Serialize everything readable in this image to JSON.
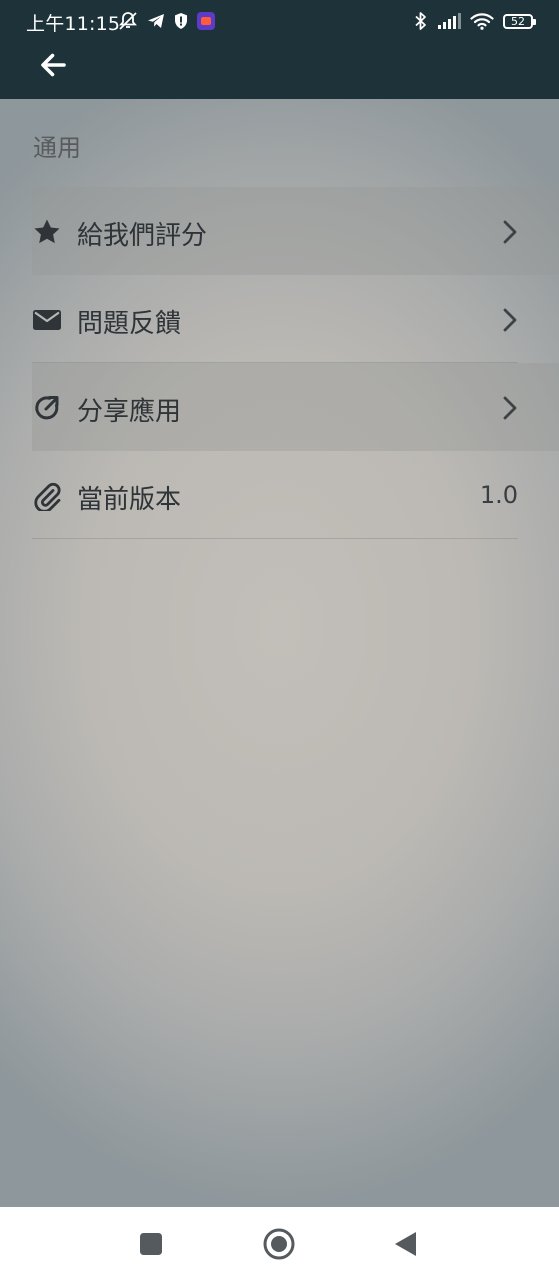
{
  "status_bar": {
    "time": "上午11:15",
    "battery": "52",
    "icons": [
      "mute-icon",
      "telegram-icon",
      "shield-icon",
      "app-icon",
      "bluetooth-icon",
      "signal-icon",
      "wifi-icon",
      "battery-icon"
    ]
  },
  "app_bar": {
    "back_icon": "arrow-left-icon",
    "background": "#1d3239"
  },
  "settings": {
    "section_title": "通用",
    "items": [
      {
        "label": "給我們評分",
        "icon": "star-icon",
        "trailing": "chevron-right-icon"
      },
      {
        "label": "問題反饋",
        "icon": "mail-icon",
        "trailing": "chevron-right-icon"
      },
      {
        "label": "分享應用",
        "icon": "share-icon",
        "trailing": "chevron-right-icon"
      },
      {
        "label": "當前版本",
        "icon": "paperclip-icon",
        "value": "1.0"
      }
    ]
  },
  "nav_bar": {
    "buttons": [
      "recents-square-icon",
      "home-circle-icon",
      "back-triangle-icon"
    ]
  }
}
